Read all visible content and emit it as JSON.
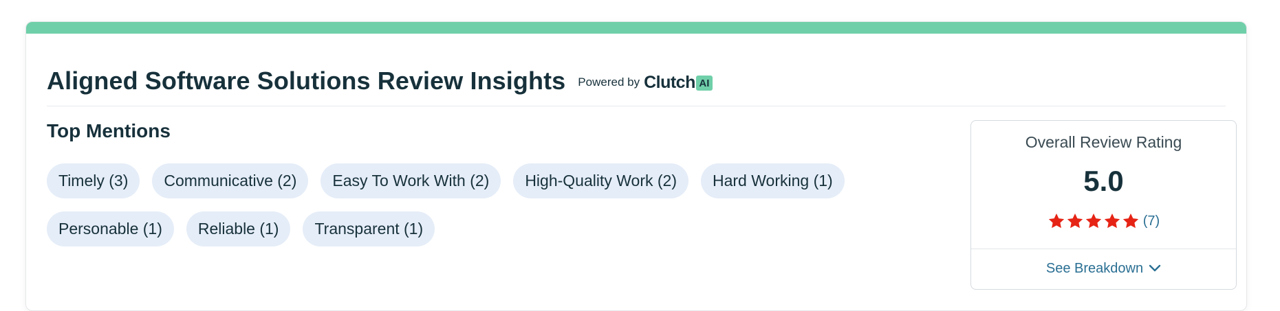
{
  "header": {
    "title": "Aligned Software Solutions Review Insights",
    "powered_by": "Powered by",
    "brand": "Clutch",
    "brand_badge": "AI"
  },
  "colors": {
    "accent": "#6fcfa9",
    "chip_bg": "#e5edf8",
    "star": "#e62415",
    "link": "#2a6f93",
    "text": "#17313b"
  },
  "mentions": {
    "title": "Top Mentions",
    "chips": [
      "Timely (3)",
      "Communicative (2)",
      "Easy To Work With (2)",
      "High-Quality Work (2)",
      "Hard Working (1)",
      "Personable (1)",
      "Reliable (1)",
      "Transparent (1)"
    ]
  },
  "rating": {
    "label": "Overall Review Rating",
    "score": "5.0",
    "stars": 5,
    "count": "(7)",
    "breakdown_label": "See Breakdown",
    "breakdown_icon": "chevron-down-icon",
    "star_icon": "star-icon"
  }
}
